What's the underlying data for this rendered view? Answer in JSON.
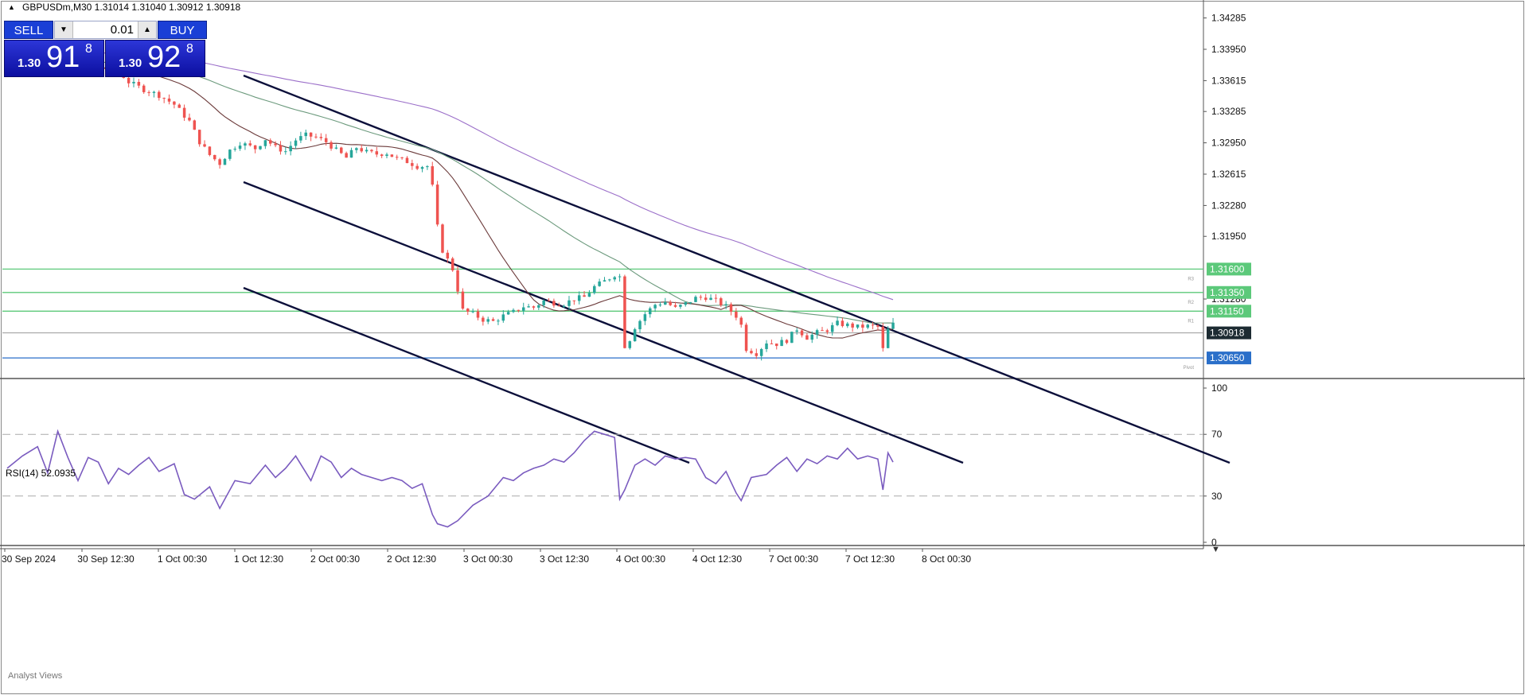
{
  "header": {
    "symbol_line": "GBPUSDm,M30  1.31014 1.31040 1.30912 1.30918",
    "indicator_label": "RSI(14) 52.0935",
    "bottom_tab_label": "Analyst Views"
  },
  "trade_panel": {
    "sell_label": "SELL",
    "buy_label": "BUY",
    "lot_value": "0.01",
    "sell_price_small": "1.30",
    "sell_price_big": "91",
    "sell_price_sup": "8",
    "buy_price_small": "1.30",
    "buy_price_big": "92",
    "buy_price_sup": "8"
  },
  "colors": {
    "up_candle": "#26a69a",
    "down_candle": "#ef5350",
    "ma_purple": "#9b6fc9",
    "ma_green": "#6c9a7d",
    "ma_brown": "#6b3a3a",
    "level_green": "#5cc97a",
    "level_blue": "#2a6fc9",
    "channel": "#0b0f3a",
    "rsi_line": "#7a5bbf",
    "current_price_bg": "#1d2b32"
  },
  "chart_data": {
    "type": "candlestick",
    "symbol": "GBPUSDm",
    "timeframe": "M30",
    "ohlc_header": {
      "open": 1.31014,
      "high": 1.3104,
      "low": 1.30912,
      "close": 1.30918
    },
    "price_axis": {
      "ticks": [
        "1.34285",
        "1.33950",
        "1.33615",
        "1.33285",
        "1.32950",
        "1.32615",
        "1.32280",
        "1.31950",
        "1.31280"
      ],
      "ylim": [
        1.3043,
        1.3446
      ]
    },
    "time_axis_labels": [
      "30 Sep 2024",
      "30 Sep 12:30",
      "1 Oct 00:30",
      "1 Oct 12:30",
      "2 Oct 00:30",
      "2 Oct 12:30",
      "3 Oct 00:30",
      "3 Oct 12:30",
      "4 Oct 00:30",
      "4 Oct 12:30",
      "7 Oct 00:30",
      "7 Oct 12:30",
      "8 Oct 00:30"
    ],
    "horizontal_levels": [
      {
        "price": 1.316,
        "label": "1.31600",
        "tag": "R3",
        "color": "#5cc97a"
      },
      {
        "price": 1.3135,
        "label": "1.31350",
        "tag": "R2",
        "color": "#5cc97a"
      },
      {
        "price": 1.3115,
        "label": "1.31150",
        "tag": "R1",
        "color": "#5cc97a"
      },
      {
        "price": 1.3065,
        "label": "1.30650",
        "tag": "Pivot",
        "color": "#2a6fc9"
      }
    ],
    "current_price": {
      "price": 1.30918,
      "label": "1.30918"
    },
    "close_path": [
      [
        0,
        1.3378
      ],
      [
        8,
        1.3376
      ],
      [
        14,
        1.3373
      ],
      [
        18,
        1.3375
      ],
      [
        22,
        1.3372
      ],
      [
        24,
        1.336
      ],
      [
        27,
        1.3352
      ],
      [
        30,
        1.3346
      ],
      [
        33,
        1.3336
      ],
      [
        36,
        1.3318
      ],
      [
        38,
        1.3296
      ],
      [
        40,
        1.3282
      ],
      [
        42,
        1.3273
      ],
      [
        44,
        1.3287
      ],
      [
        46,
        1.3295
      ],
      [
        49,
        1.3289
      ],
      [
        51,
        1.3299
      ],
      [
        53,
        1.329
      ],
      [
        55,
        1.3286
      ],
      [
        57,
        1.3298
      ],
      [
        59,
        1.3303
      ],
      [
        61,
        1.3301
      ],
      [
        63,
        1.3296
      ],
      [
        65,
        1.3287
      ],
      [
        67,
        1.3279
      ],
      [
        69,
        1.329
      ],
      [
        71,
        1.3285
      ],
      [
        73,
        1.3283
      ],
      [
        75,
        1.3284
      ],
      [
        77,
        1.3278
      ],
      [
        79,
        1.3275
      ],
      [
        81,
        1.327
      ],
      [
        83,
        1.327
      ],
      [
        84,
        1.3248
      ],
      [
        85,
        1.3205
      ],
      [
        86,
        1.318
      ],
      [
        88,
        1.316
      ],
      [
        90,
        1.3116
      ],
      [
        92,
        1.3112
      ],
      [
        94,
        1.3106
      ],
      [
        96,
        1.3104
      ],
      [
        98,
        1.311
      ],
      [
        100,
        1.3114
      ],
      [
        102,
        1.312
      ],
      [
        104,
        1.3119
      ],
      [
        106,
        1.3126
      ],
      [
        108,
        1.3124
      ],
      [
        110,
        1.3123
      ],
      [
        112,
        1.3128
      ],
      [
        114,
        1.313
      ],
      [
        116,
        1.3141
      ],
      [
        118,
        1.3147
      ],
      [
        120,
        1.3154
      ],
      [
        121,
        1.3152
      ],
      [
        122,
        1.3078
      ],
      [
        123,
        1.3085
      ],
      [
        124,
        1.3098
      ],
      [
        126,
        1.3112
      ],
      [
        128,
        1.3122
      ],
      [
        130,
        1.3125
      ],
      [
        132,
        1.3118
      ],
      [
        134,
        1.3123
      ],
      [
        136,
        1.3129
      ],
      [
        138,
        1.313
      ],
      [
        140,
        1.3126
      ],
      [
        142,
        1.312
      ],
      [
        144,
        1.311
      ],
      [
        145,
        1.31
      ],
      [
        146,
        1.3075
      ],
      [
        148,
        1.307
      ],
      [
        150,
        1.3082
      ],
      [
        152,
        1.308
      ],
      [
        154,
        1.3084
      ],
      [
        156,
        1.3096
      ],
      [
        158,
        1.3087
      ],
      [
        160,
        1.3092
      ],
      [
        162,
        1.3095
      ],
      [
        164,
        1.3102
      ],
      [
        166,
        1.31
      ],
      [
        168,
        1.3098
      ],
      [
        170,
        1.3099
      ],
      [
        172,
        1.3098
      ],
      [
        173,
        1.3074
      ],
      [
        174,
        1.3095
      ],
      [
        175,
        1.3101
      ]
    ],
    "rsi": {
      "name": "RSI(14)",
      "last": 52.0935,
      "levels": [
        30,
        70
      ],
      "ticks": [
        "100",
        "70",
        "30",
        "0"
      ],
      "ylim": [
        0,
        100
      ],
      "values": [
        [
          0,
          48
        ],
        [
          3,
          56
        ],
        [
          6,
          62
        ],
        [
          8,
          45
        ],
        [
          10,
          72
        ],
        [
          12,
          55
        ],
        [
          14,
          40
        ],
        [
          16,
          55
        ],
        [
          18,
          52
        ],
        [
          20,
          38
        ],
        [
          22,
          48
        ],
        [
          24,
          44
        ],
        [
          26,
          50
        ],
        [
          28,
          55
        ],
        [
          30,
          46
        ],
        [
          33,
          51
        ],
        [
          35,
          31
        ],
        [
          37,
          28
        ],
        [
          40,
          36
        ],
        [
          42,
          22
        ],
        [
          45,
          40
        ],
        [
          48,
          38
        ],
        [
          51,
          50
        ],
        [
          53,
          42
        ],
        [
          55,
          48
        ],
        [
          57,
          56
        ],
        [
          60,
          40
        ],
        [
          62,
          56
        ],
        [
          64,
          52
        ],
        [
          66,
          42
        ],
        [
          68,
          48
        ],
        [
          70,
          44
        ],
        [
          72,
          42
        ],
        [
          74,
          40
        ],
        [
          76,
          42
        ],
        [
          78,
          40
        ],
        [
          80,
          35
        ],
        [
          82,
          38
        ],
        [
          84,
          18
        ],
        [
          85,
          12
        ],
        [
          87,
          10
        ],
        [
          89,
          14
        ],
        [
          92,
          24
        ],
        [
          95,
          30
        ],
        [
          98,
          42
        ],
        [
          100,
          40
        ],
        [
          102,
          45
        ],
        [
          104,
          48
        ],
        [
          106,
          50
        ],
        [
          108,
          54
        ],
        [
          110,
          52
        ],
        [
          112,
          58
        ],
        [
          114,
          66
        ],
        [
          116,
          72
        ],
        [
          118,
          70
        ],
        [
          120,
          68
        ],
        [
          121,
          28
        ],
        [
          122,
          34
        ],
        [
          124,
          50
        ],
        [
          126,
          54
        ],
        [
          128,
          50
        ],
        [
          130,
          56
        ],
        [
          132,
          54
        ],
        [
          134,
          55
        ],
        [
          136,
          54
        ],
        [
          138,
          42
        ],
        [
          140,
          38
        ],
        [
          142,
          46
        ],
        [
          144,
          32
        ],
        [
          145,
          27
        ],
        [
          147,
          42
        ],
        [
          150,
          44
        ],
        [
          152,
          50
        ],
        [
          154,
          55
        ],
        [
          156,
          46
        ],
        [
          158,
          54
        ],
        [
          160,
          51
        ],
        [
          162,
          56
        ],
        [
          164,
          54
        ],
        [
          166,
          61
        ],
        [
          168,
          54
        ],
        [
          170,
          56
        ],
        [
          172,
          54
        ],
        [
          173,
          34
        ],
        [
          174,
          58
        ],
        [
          175,
          52
        ]
      ]
    },
    "grid": false
  }
}
